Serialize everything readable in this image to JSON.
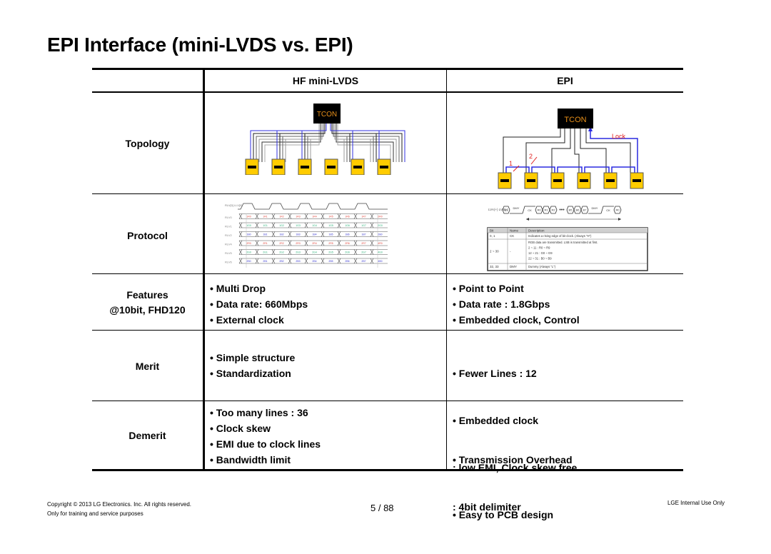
{
  "slide": {
    "title": "EPI Interface (mini-LVDS vs. EPI)"
  },
  "table": {
    "headers": {
      "col1": "HF mini-LVDS",
      "col2": "EPI"
    },
    "rows": {
      "topology": {
        "label": "Topology",
        "mini_lvds_diagram": {
          "chip_label": "TCON",
          "receiver_count": 6
        },
        "epi_diagram": {
          "chip_label": "TCON",
          "lock_label": "Lock",
          "marker_1": "1",
          "marker_2": "2",
          "receiver_count": 6
        }
      },
      "protocol": {
        "label": "Protocol",
        "mini_lvds_timing": {
          "clock_label": "RLV[0] LLV[0]",
          "lanes": [
            {
              "name": "RLV0",
              "color": "#e0453a",
              "values": [
                "1R0",
                "1R1",
                "1R2",
                "1R3",
                "1R4",
                "1R5",
                "1R6",
                "1R7",
                "2R0"
              ]
            },
            {
              "name": "RLV1",
              "color": "#2db37a",
              "values": [
                "1G0",
                "1G1",
                "1G2",
                "1G3",
                "1G4",
                "1G5",
                "1G6",
                "1G7",
                "2G0"
              ]
            },
            {
              "name": "RLV2",
              "color": "#3a3ad0",
              "values": [
                "1B0",
                "1B1",
                "1B2",
                "1B3",
                "1B4",
                "1B5",
                "1B6",
                "1B7",
                "2B0"
              ]
            },
            {
              "name": "RLV4",
              "color": "#e0453a",
              "values": [
                "2R0",
                "2R1",
                "2R2",
                "2R3",
                "2R4",
                "2R5",
                "2R6",
                "2R7",
                "4R0"
              ]
            },
            {
              "name": "RLV5",
              "color": "#2db37a",
              "values": [
                "2G0",
                "2G1",
                "2G2",
                "2G3",
                "2G4",
                "2G5",
                "2G6",
                "2G7",
                "4G0"
              ]
            },
            {
              "name": "RLV6",
              "color": "#3a3ad0",
              "values": [
                "2B0",
                "2B1",
                "2B2",
                "2B3",
                "2B4",
                "2B5",
                "2B6",
                "2B7",
                "4B0"
              ]
            }
          ]
        },
        "epi_timing": {
          "signal_label": "LVA(+) LVB(-)",
          "segments": [
            "B9",
            "DMY",
            "CK",
            "R0",
            "R1",
            "R2",
            "...",
            "B5",
            "B6",
            "B7",
            "DMY",
            "CK",
            "R0"
          ]
        },
        "epi_table": {
          "columns": [
            "Bit",
            "Name",
            "Description"
          ],
          "rows": [
            {
              "bit": "0, 1",
              "name": "CK",
              "description": [
                "Indicates a rising edge of bit clock. (Always \"H\")"
              ]
            },
            {
              "bit": "2 ~ 30",
              "name": "-",
              "description": [
                "RGB data are transmitted. LSB is transmitted at first.",
                "2 ~ 11 : R0 ~ R9",
                "12 ~ 21 : G0 ~ G9",
                "22 ~ 31 : B0 ~ B9"
              ]
            },
            {
              "bit": "32, 33",
              "name": "DMY",
              "description": [
                "Dummy (Always \"L\")"
              ]
            }
          ]
        }
      },
      "features": {
        "label_line1": "Features",
        "label_line2": "@10bit, FHD120",
        "mini_lvds": [
          "• Multi Drop",
          "• Data rate: 660Mbps",
          "• External clock"
        ],
        "epi": [
          "• Point to Point",
          "• Data rate : 1.8Gbps",
          "• Embedded clock, Control"
        ]
      },
      "merit": {
        "label": "Merit",
        "mini_lvds": [
          "• Simple structure",
          "• Standardization"
        ],
        "epi": [
          "• Fewer Lines : 12",
          "• Embedded clock",
          "   : low EMI, Clock skew free",
          "• Easy to PCB design"
        ]
      },
      "demerit": {
        "label": "Demerit",
        "mini_lvds": [
          "• Too many lines : 36",
          "• Clock skew",
          "• EMI due to clock lines",
          "• Bandwidth limit"
        ],
        "epi": [
          "• Transmission Overhead",
          "   : 4bit delimiter"
        ]
      }
    }
  },
  "footer": {
    "copyright": "Copyright © 2013 LG Electronics. Inc. All rights reserved.",
    "note": "Only for training and service purposes",
    "page": "5 / 88",
    "classification": "LGE Internal Use Only"
  },
  "colors": {
    "chip_fill": "#000000",
    "chip_text": "#e8901a",
    "receiver_fill": "#ffcc00",
    "bus_blue": "#2a2ae0",
    "lock_red": "#e02020"
  }
}
